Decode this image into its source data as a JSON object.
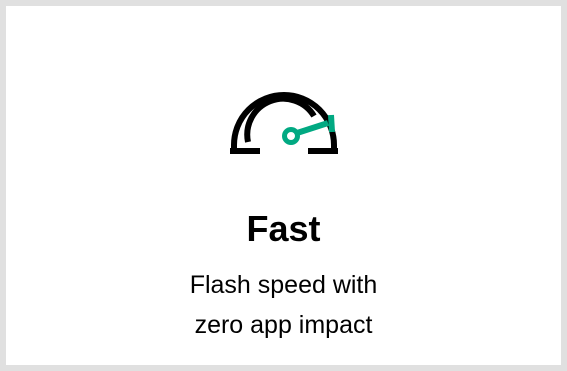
{
  "feature": {
    "icon": "speedometer-icon",
    "title": "Fast",
    "description_line1": "Flash speed with",
    "description_line2": "zero app impact"
  },
  "colors": {
    "accent": "#01A982",
    "outline": "#000000",
    "card_background": "#ffffff",
    "frame": "#e0e0e0"
  }
}
